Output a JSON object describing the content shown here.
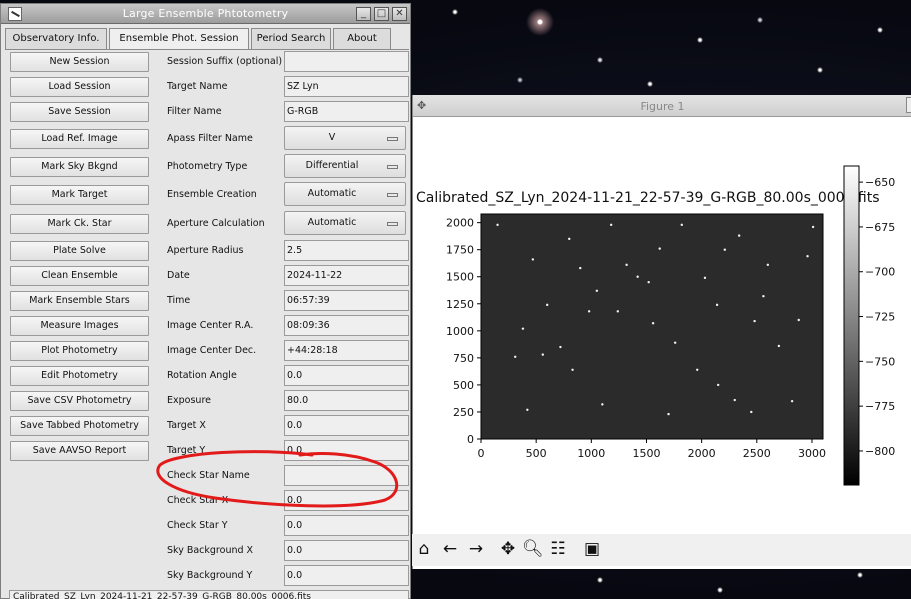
{
  "photometry_window": {
    "title": "Large Ensemble Phtotometry",
    "window_buttons": {
      "minimize": "_",
      "maximize": "□",
      "close": "✕"
    },
    "tabs": [
      {
        "label": "Observatory Info."
      },
      {
        "label": "Ensemble Phot. Session"
      },
      {
        "label": "Period Search"
      },
      {
        "label": "About"
      }
    ],
    "buttons": [
      "New Session",
      "Load Session",
      "Save Session",
      "Load Ref. Image",
      "Mark Sky Bkgnd",
      "Mark Target",
      "Mark Ck. Star",
      "Plate Solve",
      "Clean Ensemble",
      "Mark Ensemble Stars",
      "Measure Images",
      "Plot Photometry",
      "Edit Photometry",
      "Save CSV Photometry",
      "Save Tabbed Photometry",
      "Save AAVSO Report"
    ],
    "fields": {
      "session_suffix": {
        "label": "Session Suffix (optional)",
        "value": ""
      },
      "target_name": {
        "label": "Target Name",
        "value": "SZ Lyn"
      },
      "filter_name": {
        "label": "Filter Name",
        "value": "G-RGB"
      },
      "apass_filter": {
        "label": "Apass Filter Name",
        "value": "V"
      },
      "photometry_type": {
        "label": "Photometry Type",
        "value": "Differential"
      },
      "ensemble_creation": {
        "label": "Ensemble Creation",
        "value": "Automatic"
      },
      "aperture_calc": {
        "label": "Aperture Calculation",
        "value": "Automatic"
      },
      "aperture_radius": {
        "label": "Aperture Radius",
        "value": "2.5"
      },
      "date": {
        "label": "Date",
        "value": "2024-11-22"
      },
      "time": {
        "label": "Time",
        "value": "06:57:39"
      },
      "center_ra": {
        "label": "Image Center R.A.",
        "value": "08:09:36"
      },
      "center_dec": {
        "label": "Image Center Dec.",
        "value": "+44:28:18"
      },
      "rotation": {
        "label": "Rotation Angle",
        "value": "0.0"
      },
      "exposure": {
        "label": "Exposure",
        "value": "80.0"
      },
      "target_x": {
        "label": "Target X",
        "value": "0.0"
      },
      "target_y": {
        "label": "Target Y",
        "value": "0.0"
      },
      "check_star_name": {
        "label": "Check Star Name",
        "value": ""
      },
      "check_star_x": {
        "label": "Check Star X",
        "value": "0.0"
      },
      "check_star_y": {
        "label": "Check Star Y",
        "value": "0.0"
      },
      "sky_bg_x": {
        "label": "Sky Background X",
        "value": "0.0"
      },
      "sky_bg_y": {
        "label": "Sky Background Y",
        "value": "0.0"
      }
    },
    "status_text": "Calibrated_SZ_Lyn_2024-11-21_22-57-39_G-RGB_80.00s_0006.fits"
  },
  "figure_window": {
    "title": "Figure 1",
    "plot_title": "Calibrated_SZ_Lyn_2024-11-21_22-57-39_G-RGB_80.00s_0006.fits",
    "toolbar_icons": [
      "home-icon",
      "back-icon",
      "forward-icon",
      "pan-icon",
      "zoom-icon",
      "configure-subplots-icon",
      "save-icon"
    ]
  },
  "chart_data": {
    "type": "heatmap",
    "title": "Calibrated_SZ_Lyn_2024-11-21_22-57-39_G-RGB_80.00s_0006.fits",
    "x_ticks": [
      0,
      500,
      1000,
      1500,
      2000,
      2500,
      3000
    ],
    "y_ticks": [
      0,
      250,
      500,
      750,
      1000,
      1250,
      1500,
      1750,
      2000
    ],
    "xlim": [
      0,
      3100
    ],
    "ylim": [
      0,
      2080
    ],
    "colorbar": {
      "ticks": [
        -650,
        -675,
        -700,
        -725,
        -750,
        -775,
        -800
      ],
      "range": [
        -819,
        -641
      ],
      "colormap": "gray"
    },
    "stars": [
      [
        150,
        1980
      ],
      [
        310,
        760
      ],
      [
        560,
        780
      ],
      [
        830,
        640
      ],
      [
        900,
        1580
      ],
      [
        1050,
        1370
      ],
      [
        1420,
        1500
      ],
      [
        1520,
        1450
      ],
      [
        1560,
        1070
      ],
      [
        1240,
        1180
      ],
      [
        2030,
        1490
      ],
      [
        2210,
        1750
      ],
      [
        2960,
        1690
      ],
      [
        2600,
        1610
      ],
      [
        2480,
        1090
      ],
      [
        2300,
        360
      ],
      [
        2150,
        500
      ],
      [
        1700,
        230
      ],
      [
        1100,
        320
      ],
      [
        420,
        270
      ],
      [
        720,
        850
      ],
      [
        980,
        1180
      ],
      [
        2450,
        250
      ],
      [
        2820,
        350
      ],
      [
        600,
        1240
      ],
      [
        1820,
        1980
      ],
      [
        2700,
        860
      ],
      [
        3010,
        1960
      ],
      [
        1320,
        1610
      ],
      [
        1760,
        890
      ],
      [
        2560,
        1320
      ],
      [
        380,
        1020
      ],
      [
        1180,
        1980
      ],
      [
        2880,
        1100
      ],
      [
        1960,
        640
      ],
      [
        800,
        1850
      ],
      [
        2140,
        1240
      ],
      [
        470,
        1660
      ],
      [
        1620,
        1760
      ],
      [
        2340,
        1880
      ]
    ]
  }
}
